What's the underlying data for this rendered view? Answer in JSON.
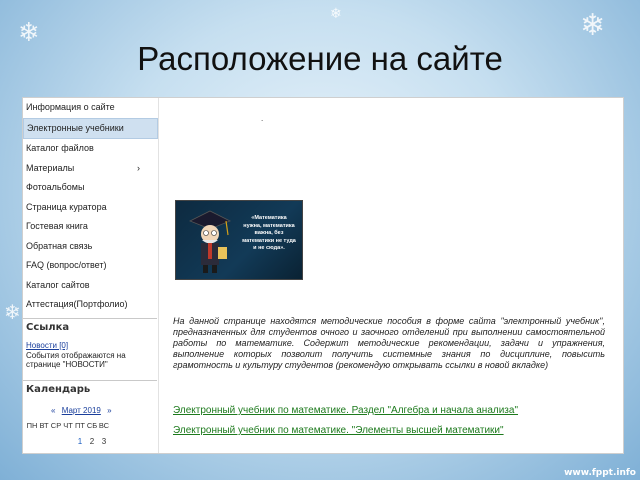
{
  "slide": {
    "title": "Расположение на сайте"
  },
  "sidebar": {
    "menu": [
      {
        "label": "Информация о сайте"
      },
      {
        "label": "Электронные учебники",
        "active": true
      },
      {
        "label": "Каталог файлов"
      },
      {
        "label": "Материалы",
        "submenu_icon": "›"
      },
      {
        "label": "Фотоальбомы"
      },
      {
        "label": "Страница куратора"
      },
      {
        "label": "Гостевая книга"
      },
      {
        "label": "Обратная связь"
      },
      {
        "label": "FAQ (вопрос/ответ)"
      },
      {
        "label": "Каталог сайтов"
      },
      {
        "label_part1": "Аттестация",
        "label_part2": "(Портфолио)"
      }
    ],
    "link_section": {
      "heading": "Ссылка",
      "news_label": "Новости [0]",
      "note": "События отображаются на странице \"НОВОСТИ\""
    },
    "calendar": {
      "heading": "Календарь",
      "prev": "«",
      "month": "Март 2019",
      "next": "»",
      "weekdays": [
        "ПН",
        "ВТ",
        "СР",
        "ЧТ",
        "ПТ",
        "СБ",
        "ВС"
      ],
      "days": [
        "1",
        "2",
        "3"
      ]
    }
  },
  "main": {
    "marker": ".",
    "quote": "«Математика нужна, математика важна, без математики не туда и не сюда».",
    "description": "На данной странице находятся методические пособия в форме сайта \"электронный учебник\", предназначенных для студентов очного и заочного отделений при выполнении самостоятельной работы по математике. Содержит методические рекомендации, задачи и упражнения, выполнение которых позволит получить системные знания по дисциплине, повысить грамотность и культуру студентов (рекомендую открывать ссылки в новой вкладке)",
    "links": [
      "Электронный учебник по математике. Раздел \"Алгебра и начала анализа\"",
      "Электронный учебник по математике. \"Элементы высшей математики\""
    ]
  },
  "footer": {
    "watermark": "www.fppt.info"
  },
  "colors": {
    "link_green": "#1d7a1d",
    "link_blue": "#1a3f9c",
    "active_bg": "#cfe0f0"
  }
}
